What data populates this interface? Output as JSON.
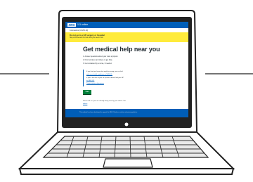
{
  "header": {
    "logo": "NHS",
    "service": "111 online"
  },
  "breadcrumb": "Coronavirus (COVID-19)",
  "alert": {
    "title": "Do not go to a GP surgery or hospital",
    "body": "Stay at home and find out what you need to do."
  },
  "page_title": "Get medical help near you",
  "steps": [
    "1. Answer questions about your main symptom.",
    "2. Find out when and where to get help.",
    "3. Get contacted by a nurse, if needed."
  ],
  "inset": {
    "line1": "If you think you know what might be wrong, you can find",
    "link1": "advice on health conditions on NHS.UK.",
    "line2": "If you're not sure of your GP practice details, find your GP",
    "link2": "on NHS.UK.",
    "line3": "Try our service alternatives"
  },
  "start_label": "Start",
  "note": "Please tell us if you are already being seen by your doctor. Get",
  "note_link": "advice",
  "footer_text": "This website has been developed to support the NHS. Read our cookies and privacy policies.",
  "colors": {
    "nhs_blue": "#005eb8",
    "alert_yellow": "#ffeb3b",
    "start_green": "#007f3b"
  }
}
